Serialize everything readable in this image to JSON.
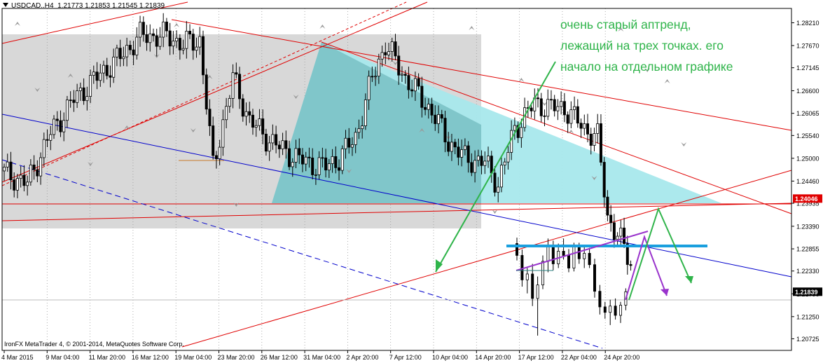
{
  "header": {
    "symbol": "USDCAD..H4",
    "ohlc": "1.21773 1.21853 1.21545 1.21839"
  },
  "annotation": {
    "lines": [
      "очень старый аптренд,",
      "лежащий на трех точках. его",
      "начало на отдельном графике"
    ]
  },
  "copyright": "IronFX MetaTrader 4, © 2001-2014, MetaQuotes Software Corp.",
  "colors": {
    "bull": "#000000",
    "bear": "#000000",
    "trend_red": "#e00000",
    "trend_blue": "#0000cc",
    "annotation_green": "#2fb44a",
    "level_cyan": "#1a9fde",
    "triangle_cyan": "#a8e8ec",
    "purple": "#9933cc",
    "grey_zone": "#d4d4d4"
  },
  "chart_data": {
    "type": "candlestick",
    "symbol": "USDCAD",
    "timeframe": "H4",
    "ylim": [
      1.2045,
      1.2855
    ],
    "y_ticks": [
      "1.28210",
      "1.27670",
      "1.27145",
      "1.26600",
      "1.26065",
      "1.25540",
      "1.25000",
      "1.24460",
      "1.23935",
      "1.23390",
      "1.22855",
      "1.22330",
      "1.21790",
      "1.21250",
      "1.20725"
    ],
    "x_ticks": [
      "4 Mar 2015",
      "9 Mar 04:00",
      "11 Mar 20:00",
      "16 Mar 12:00",
      "19 Mar 04:00",
      "23 Mar 20:00",
      "26 Mar 12:00",
      "31 Mar 04:00",
      "2 Apr 20:00",
      "7 Apr 12:00",
      "10 Apr 04:00",
      "14 Apr 20:00",
      "17 Apr 12:00",
      "22 Apr 04:00",
      "24 Apr 20:00"
    ],
    "price_labels": [
      {
        "value": 1.24046,
        "text": "1.24046",
        "color": "#e00000"
      },
      {
        "value": 1.21839,
        "text": "1.21839",
        "color": "#000000"
      }
    ],
    "candle_count": 190,
    "path_anchors": [
      [
        0,
        1.247
      ],
      [
        8,
        1.244
      ],
      [
        15,
        1.256
      ],
      [
        22,
        1.264
      ],
      [
        30,
        1.27
      ],
      [
        36,
        1.274
      ],
      [
        42,
        1.279
      ],
      [
        50,
        1.279
      ],
      [
        55,
        1.277
      ],
      [
        60,
        1.278
      ],
      [
        64,
        1.248
      ],
      [
        70,
        1.269
      ],
      [
        75,
        1.259
      ],
      [
        80,
        1.255
      ],
      [
        85,
        1.252
      ],
      [
        92,
        1.249
      ],
      [
        98,
        1.248
      ],
      [
        102,
        1.25
      ],
      [
        107,
        1.255
      ],
      [
        112,
        1.269
      ],
      [
        116,
        1.277
      ],
      [
        122,
        1.269
      ],
      [
        130,
        1.261
      ],
      [
        135,
        1.254
      ],
      [
        140,
        1.25
      ],
      [
        146,
        1.249
      ],
      [
        150,
        1.244
      ],
      [
        155,
        1.257
      ],
      [
        161,
        1.263
      ],
      [
        166,
        1.262
      ],
      [
        170,
        1.262
      ],
      [
        176,
        1.257
      ],
      [
        180,
        1.255
      ],
      [
        183,
        1.236
      ],
      [
        186,
        1.232
      ],
      [
        190,
        1.225
      ]
    ],
    "candles_tail": [
      [
        1.2298,
        1.2312,
        1.2258,
        1.227
      ],
      [
        1.227,
        1.2284,
        1.2196,
        1.2212
      ],
      [
        1.2212,
        1.224,
        1.218,
        1.2226
      ],
      [
        1.2226,
        1.225,
        1.215,
        1.2168
      ],
      [
        1.2168,
        1.222,
        1.208,
        1.22
      ],
      [
        1.22,
        1.227,
        1.219,
        1.2256
      ],
      [
        1.2256,
        1.231,
        1.223,
        1.229
      ],
      [
        1.229,
        1.2305,
        1.2235,
        1.225
      ],
      [
        1.225,
        1.2298,
        1.224,
        1.228
      ],
      [
        1.228,
        1.231,
        1.226,
        1.227
      ],
      [
        1.227,
        1.2285,
        1.223,
        1.224
      ],
      [
        1.224,
        1.23,
        1.2232,
        1.229
      ],
      [
        1.229,
        1.23,
        1.225,
        1.2262
      ],
      [
        1.2262,
        1.229,
        1.224,
        1.2275
      ],
      [
        1.2275,
        1.2288,
        1.224,
        1.2248
      ],
      [
        1.2248,
        1.2262,
        1.217,
        1.2185
      ],
      [
        1.2185,
        1.22,
        1.213,
        1.2148
      ],
      [
        1.2148,
        1.216,
        1.212,
        1.2135
      ],
      [
        1.2135,
        1.2165,
        1.2105,
        1.215
      ],
      [
        1.215,
        1.2168,
        1.2118,
        1.2128
      ],
      [
        1.2128,
        1.216,
        1.211,
        1.2152
      ],
      [
        1.2152,
        1.2192,
        1.214,
        1.2184
      ]
    ]
  }
}
